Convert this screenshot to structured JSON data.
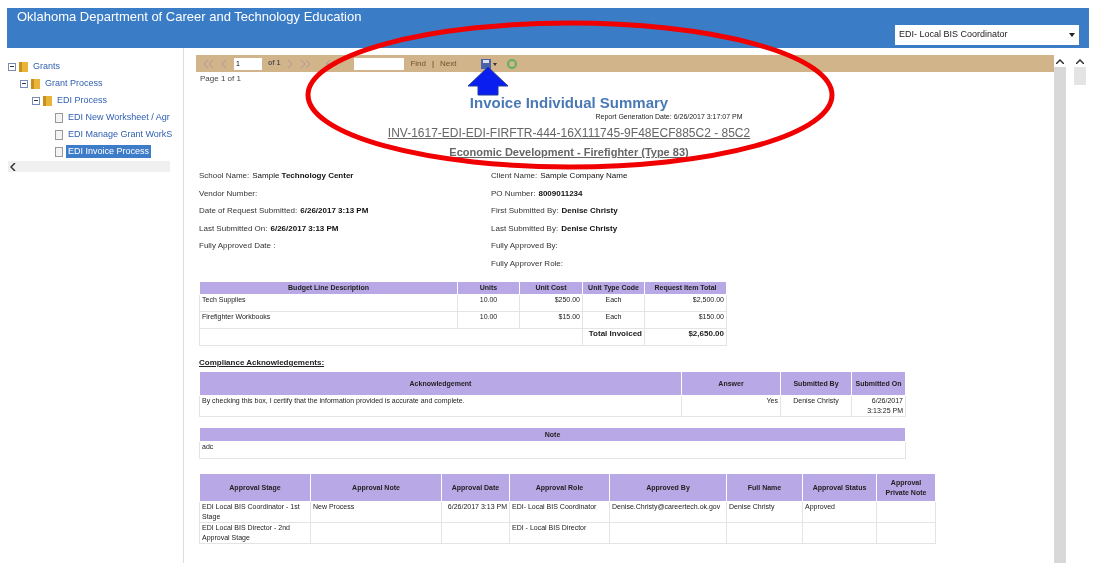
{
  "header": {
    "title": "Oklahoma Department of Career and Technology Education",
    "role_select": "EDI- Local BIS Coordinator"
  },
  "tree": [
    {
      "label": "Grants",
      "kind": "folder",
      "expanded": true,
      "selected": false,
      "children": [
        {
          "label": "Grant Process",
          "kind": "folder",
          "expanded": true,
          "selected": false,
          "children": [
            {
              "label": "EDI Process",
              "kind": "folder",
              "expanded": true,
              "selected": false,
              "children": [
                {
                  "label": "EDI New Worksheet / Agr",
                  "kind": "page",
                  "selected": false
                },
                {
                  "label": "EDI Manage Grant WorkS",
                  "kind": "page",
                  "selected": false
                },
                {
                  "label": "EDI Invoice Process",
                  "kind": "page",
                  "selected": true
                }
              ]
            }
          ]
        }
      ]
    }
  ],
  "toolbar": {
    "page_input": "1",
    "page_count": "of 1",
    "find": "Find",
    "separator": "|",
    "next": "Next"
  },
  "page_label": "Page 1 of 1",
  "report": {
    "title": "Invoice Individual Summary",
    "generated": "Report Generation Date: 6/26/2017 3:17:07 PM",
    "invoice_id": "INV-1617-EDI-EDI-FIRFTR-444-16X111745-9F48ECF885C2 - 85C2",
    "program": "Economic Development - Firefighter (Type 83)",
    "fields_left": [
      {
        "label": "School Name:",
        "value": "Sample **Technology Center**"
      },
      {
        "label": "Vendor Number:"
      },
      {
        "label": "Date of Request Submitted:",
        "value": "**6/26/2017 3:13 PM**"
      },
      {
        "label": "Last Submitted On:",
        "value": "**6/26/2017 3:13 PM**"
      },
      {
        "label": "Fully Approved Date :"
      }
    ],
    "fields_right": [
      {
        "label": "Client Name:",
        "value": "Sample Company Name"
      },
      {
        "label": "PO Number:",
        "value": "**8009011234**"
      },
      {
        "label": "First Submitted By:",
        "value": "**Denise Christy**"
      },
      {
        "label": "Last Submitted By:",
        "value": "**Denise Christy**"
      },
      {
        "label": "Fully Approved By:"
      },
      {
        "label": "Fully Approver Role:"
      }
    ],
    "budget": {
      "columns": [
        "Budget Line Description",
        "Units",
        "Unit Cost",
        "Unit Type Code",
        "Request Item Total"
      ],
      "rows": [
        [
          "Tech Supplies",
          "10.00",
          "$250.00",
          "Each",
          "$2,500.00"
        ],
        [
          "Firefighter Workbooks",
          "10.00",
          "$15.00",
          "Each",
          "$150.00"
        ]
      ],
      "total_label": "Total Invoiced",
      "total_value": "$2,650.00"
    },
    "compliance": {
      "heading": "Compliance Acknowledgements:",
      "columns": [
        "Acknowledgement",
        "Answer",
        "Submitted By",
        "Submitted On"
      ],
      "rows": [
        [
          "By checking this box, I certify that the information provided is accurate and complete.",
          "Yes",
          "Denise Christy",
          "6/26/2017 3:13:25 PM"
        ]
      ]
    },
    "note": {
      "column": "Note",
      "value": "adc"
    },
    "approvals": {
      "columns": [
        "Approval Stage",
        "Approval Note",
        "Approval Date",
        "Approval Role",
        "Approved By",
        "Full Name",
        "Approval Status",
        "Approval Private Note"
      ],
      "rows": [
        [
          "EDI Local BIS Coordinator - 1st Stage",
          "New Process",
          "6/26/2017 3:13 PM",
          "EDI- Local BIS Coordinator",
          "Denise.Christy@careertech.ok.gov",
          "Denise Christy",
          "Approved",
          ""
        ],
        [
          "EDI Local BIS Director - 2nd Approval Stage",
          "",
          "",
          "EDI - Local BIS Director",
          "",
          "",
          "",
          ""
        ]
      ]
    }
  }
}
